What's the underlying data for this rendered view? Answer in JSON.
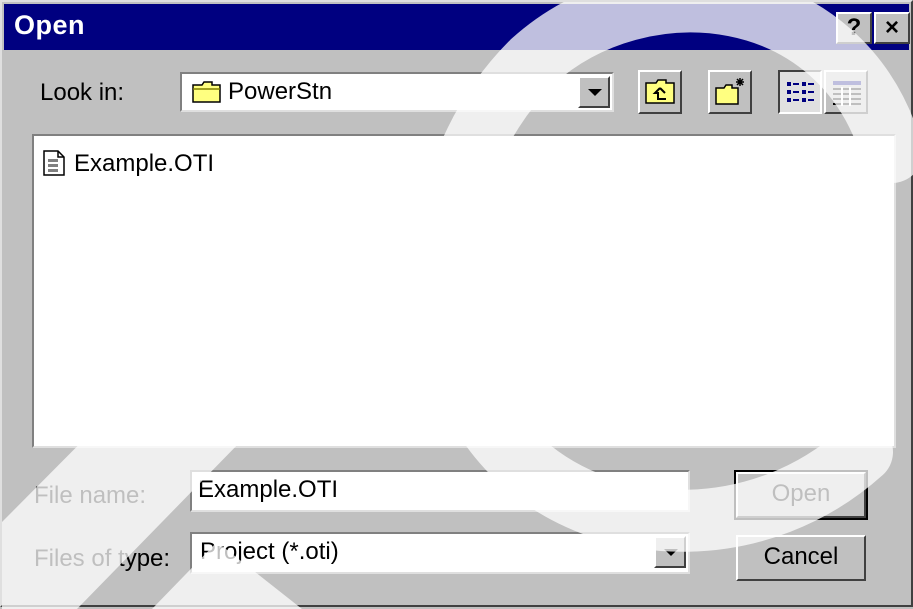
{
  "window": {
    "title": "Open",
    "help_label": "?",
    "close_label": "×"
  },
  "look_in": {
    "label": "Look in:",
    "value": "PowerStn",
    "icon": "folder-icon"
  },
  "toolbar": {
    "up_icon": "up-one-level-icon",
    "new_folder_icon": "new-folder-icon",
    "list_view_icon": "list-view-icon",
    "details_view_icon": "details-view-icon"
  },
  "files": [
    {
      "name": "Example.OTI",
      "icon": "document-icon"
    }
  ],
  "file_name": {
    "label": "File name:",
    "value": "Example.OTI"
  },
  "file_type": {
    "label": "Files of type:",
    "value": "Project (*.oti)"
  },
  "buttons": {
    "open": "Open",
    "cancel": "Cancel"
  },
  "colors": {
    "title_bar": "#000080",
    "face": "#c0c0c0"
  }
}
